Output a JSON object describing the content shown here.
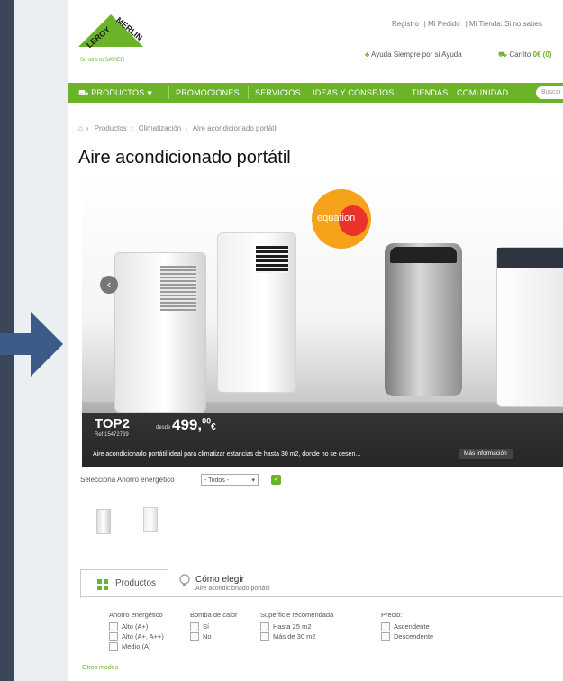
{
  "logo": {
    "brand": "LEROY MERLIN",
    "tagline": "Su otro tú SAVIER"
  },
  "header": {
    "links": [
      "Registro",
      "Mi Pedido",
      "Mi Tienda: Si no sabes"
    ],
    "help": "Ayuda Siempre por si Ayuda",
    "cart_label": "Carrito",
    "cart_count": "0€ (0)"
  },
  "nav": {
    "items": [
      "PRODUCTOS",
      "PROMOCIONES",
      "SERVICIOS",
      "IDEAS Y CONSEJOS",
      "TIENDAS",
      "COMUNIDAD"
    ],
    "search_placeholder": "Buscar"
  },
  "breadcrumb": [
    "Productos",
    "Climatización",
    "Aire acondicionado portátil"
  ],
  "page_title": "Aire acondicionado portátil",
  "hero": {
    "brand_badge": "equation",
    "product_name": "TOP2",
    "ref": "Ref.15472769",
    "price_prefix": "desde",
    "price": "499,",
    "price_cents": "00",
    "currency": "€",
    "description": "Aire acondicionado portátil ideal para climatizar estancias de hasta 30 m2, donde no se cesen...",
    "more_info": "Más información"
  },
  "energy_filter": {
    "label": "Selecciona Ahorro energético",
    "selected": "- Todos -",
    "go": "✓"
  },
  "tabs": {
    "products": "Productos",
    "guide_title": "Cómo elegir",
    "guide_subtitle": "Aire acondicionado portátil"
  },
  "filters": [
    {
      "title": "Ahorro energético",
      "options": [
        "Alto (A+)",
        "Alto (A+, A++)",
        "Medio (A)"
      ]
    },
    {
      "title": "Bomba de calor",
      "options": [
        "Sí",
        "No"
      ]
    },
    {
      "title": "Superficie recomendada",
      "options": [
        "Hasta 25 m2",
        "Más de 30 m2"
      ]
    },
    {
      "title": "Precio:",
      "options": [
        "Ascendente",
        "Descendente"
      ]
    }
  ],
  "more_filters": "Otros modos",
  "colors": {
    "brand_green": "#6bb42a",
    "backdrop": "#3a4659",
    "arrow": "#3b5a86"
  }
}
